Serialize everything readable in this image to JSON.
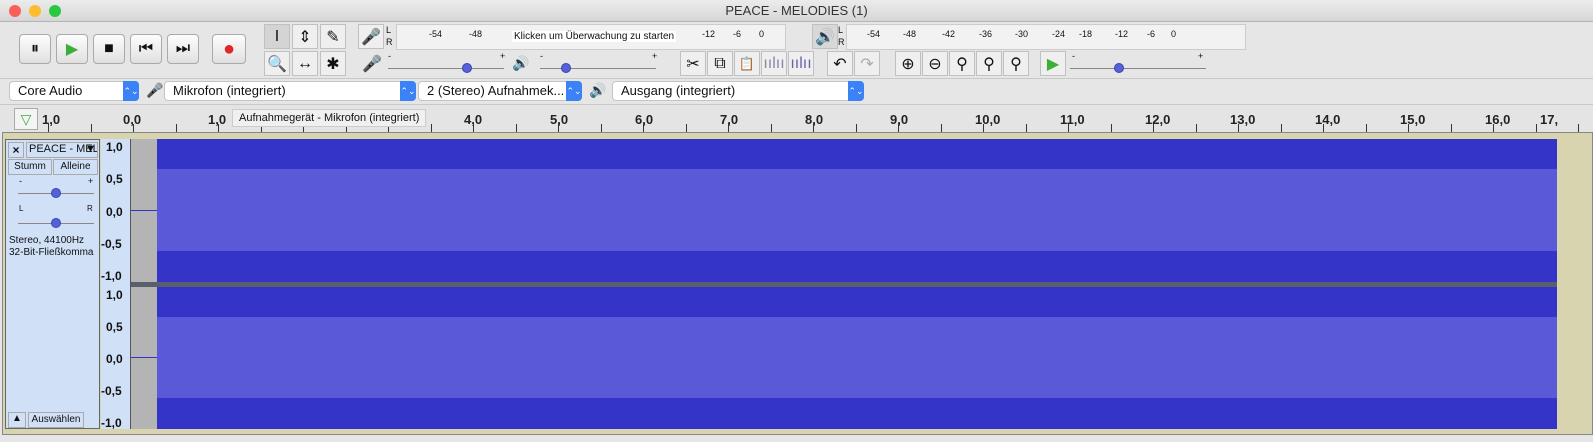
{
  "window": {
    "title": "PEACE - MELODIES (1)"
  },
  "transport": {
    "pause": "⏸",
    "play": "▶",
    "stop": "■",
    "skip_start": "⏮",
    "skip_end": "⏭",
    "record": "●"
  },
  "tools": [
    "I",
    "⇕",
    "✎",
    "🔍",
    "↔",
    "✱"
  ],
  "record_meter": {
    "channels": [
      "L",
      "R"
    ],
    "ticks": [
      "-54",
      "-48",
      "-12",
      "-6",
      "0"
    ],
    "prompt": "Klicken um Überwachung zu starten"
  },
  "playback_meter": {
    "channels": [
      "L",
      "R"
    ],
    "ticks": [
      "-54",
      "-48",
      "-42",
      "-36",
      "-30",
      "-24",
      "-18",
      "-12",
      "-6",
      "0"
    ]
  },
  "mixer": {
    "record_volume": 0.7,
    "playback_volume": 0.2,
    "minus": "-",
    "plus": "+"
  },
  "edit": {
    "cut": "✂",
    "copy": "⧉",
    "paste": "📋",
    "undo": "↶",
    "redo": "↷"
  },
  "play_at_speed": {
    "value": 0.35
  },
  "device": {
    "host": "Core Audio",
    "input": "Mikrofon (integriert)",
    "channels": "2 (Stereo) Aufnahmek...",
    "output": "Ausgang (integriert)"
  },
  "ruler": {
    "labels": [
      "1,0",
      "0,0",
      "1,0",
      "4,0",
      "5,0",
      "6,0",
      "7,0",
      "8,0",
      "9,0",
      "10,0",
      "11,0",
      "12,0",
      "13,0",
      "14,0",
      "15,0",
      "16,0",
      "17,"
    ],
    "tooltip": "Aufnahmegerät - Mikrofon (integriert)"
  },
  "track": {
    "name": "PEACE - MEL",
    "mute": "Stumm",
    "solo": "Alleine",
    "gain_minus": "-",
    "gain_plus": "+",
    "pan_left": "L",
    "pan_right": "R",
    "gain": 0.5,
    "pan": 0.5,
    "info_line1": "Stereo, 44100Hz",
    "info_line2": "32-Bit-Fließkomma",
    "select": "Auswählen",
    "close": "×",
    "scale": [
      "1,0",
      "0,5",
      "0,0",
      "-0,5",
      "-1,0"
    ]
  },
  "colors": {
    "wave_peak": "#3434c8",
    "wave_rms": "#5a5ad8",
    "track_panel": "#cfe0f7"
  }
}
